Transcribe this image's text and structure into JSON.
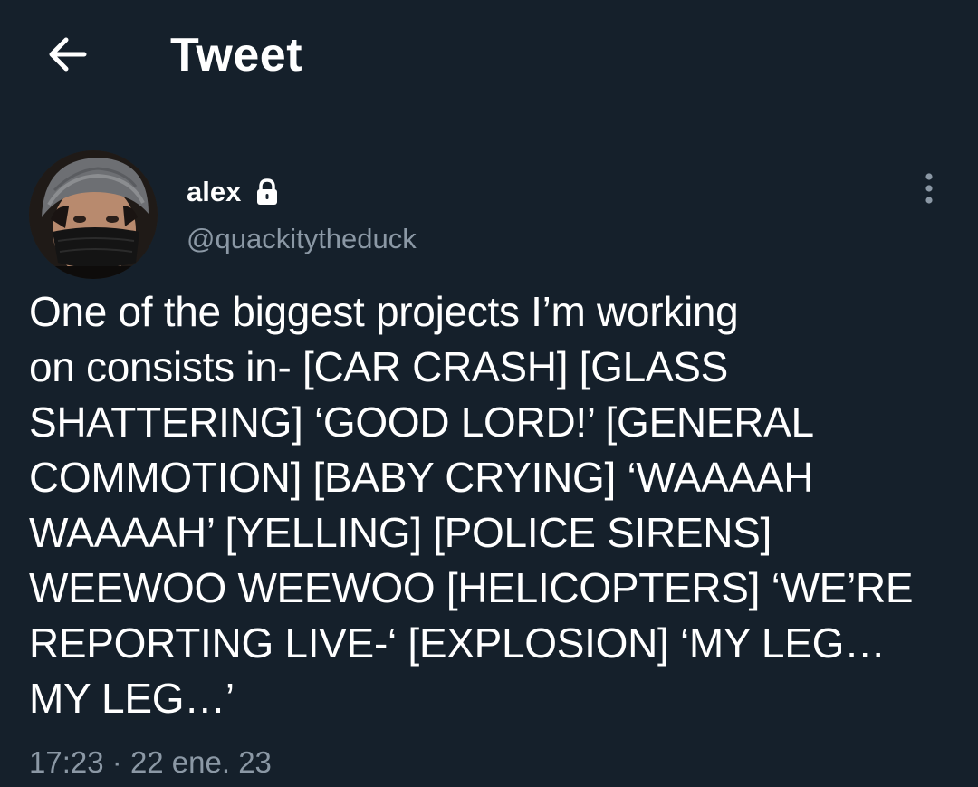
{
  "header": {
    "title": "Tweet",
    "back_icon": "arrow-left-icon"
  },
  "tweet": {
    "author": {
      "name": "alex",
      "handle": "@quackitytheduck",
      "protected_icon": "lock-icon"
    },
    "more_icon": "more-vertical-icon",
    "text": "One of the biggest projects I’m working\non consists in- [CAR CRASH] [GLASS\nSHATTERING] ‘GOOD LORD!’ [GENERAL\nCOMMOTION] [BABY CRYING] ‘WAAAAH\nWAAAAH’ [YELLING] [POLICE SIRENS]\nWEEWOO WEEWOO [HELICOPTERS] ‘WE’RE\nREPORTING LIVE-‘ [EXPLOSION] ‘MY LEG…\nMY LEG…’",
    "time": "17:23",
    "separator": "·",
    "date": "22 ene. 23"
  },
  "colors": {
    "background": "#15202b",
    "divider": "#38444d",
    "secondary_text": "#8b98a5",
    "primary_text": "#ffffff"
  }
}
